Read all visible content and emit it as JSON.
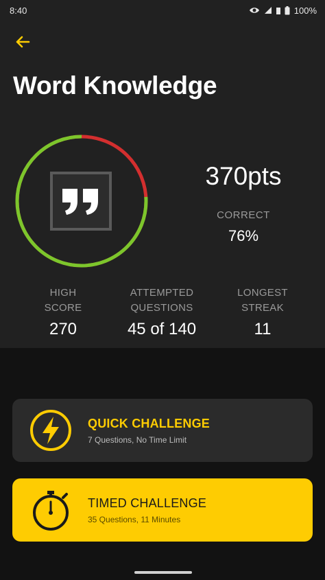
{
  "status_bar": {
    "time": "8:40",
    "battery": "100%",
    "icons": [
      "eye-icon",
      "wifi-icon",
      "signal-icon",
      "battery-icon"
    ]
  },
  "header": {
    "back_icon": "back-arrow-icon",
    "title": "Word Knowledge"
  },
  "score": {
    "points": "370pts",
    "correct_label": "CORRECT",
    "correct_value": "76%",
    "correct_fraction": 0.76,
    "ring_colors": {
      "correct": "#7cc62c",
      "incorrect": "#d32f2f"
    },
    "category_icon": "quote-icon"
  },
  "stats": [
    {
      "label_line1": "HIGH",
      "label_line2": "SCORE",
      "value": "270"
    },
    {
      "label_line1": "ATTEMPTED",
      "label_line2": "QUESTIONS",
      "value": "45 of 140"
    },
    {
      "label_line1": "LONGEST",
      "label_line2": "STREAK",
      "value": "11"
    }
  ],
  "challenges": {
    "quick": {
      "title": "QUICK CHALLENGE",
      "subtitle": "7 Questions, No Time Limit",
      "icon": "lightning-icon"
    },
    "timed": {
      "title": "TIMED CHALLENGE",
      "subtitle": "35 Questions, 11 Minutes",
      "icon": "stopwatch-icon"
    }
  },
  "colors": {
    "accent": "#fecc02",
    "background": "#121212",
    "panel": "#212121",
    "card_dark": "#2b2b2b"
  }
}
